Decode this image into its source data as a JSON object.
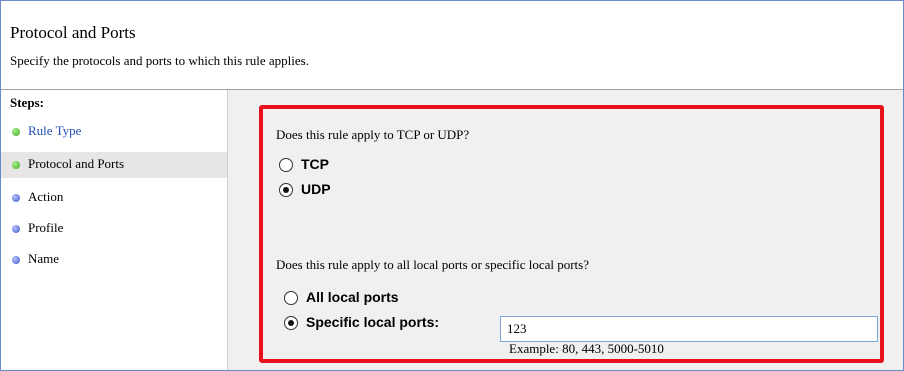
{
  "header": {
    "title": "Protocol and Ports",
    "subtitle": "Specify the protocols and ports to which this rule applies."
  },
  "sidebar": {
    "steps_label": "Steps:",
    "items": [
      {
        "label": "Rule Type",
        "status": "done"
      },
      {
        "label": "Protocol and Ports",
        "status": "current"
      },
      {
        "label": "Action",
        "status": "pending"
      },
      {
        "label": "Profile",
        "status": "pending"
      },
      {
        "label": "Name",
        "status": "pending"
      }
    ]
  },
  "protocol": {
    "question": "Does this rule apply to TCP or UDP?",
    "options": [
      {
        "label": "TCP",
        "selected": false
      },
      {
        "label": "UDP",
        "selected": true
      }
    ]
  },
  "ports": {
    "question": "Does this rule apply to all local ports or specific local ports?",
    "options": [
      {
        "label": "All local ports",
        "selected": false
      },
      {
        "label": "Specific local ports:",
        "selected": true
      }
    ],
    "value": "123",
    "example": "Example: 80, 443, 5000-5010"
  },
  "colors": {
    "highlight_border": "#e8101a",
    "done_dot": "#3fa81e",
    "pending_dot": "#3b52c8"
  }
}
